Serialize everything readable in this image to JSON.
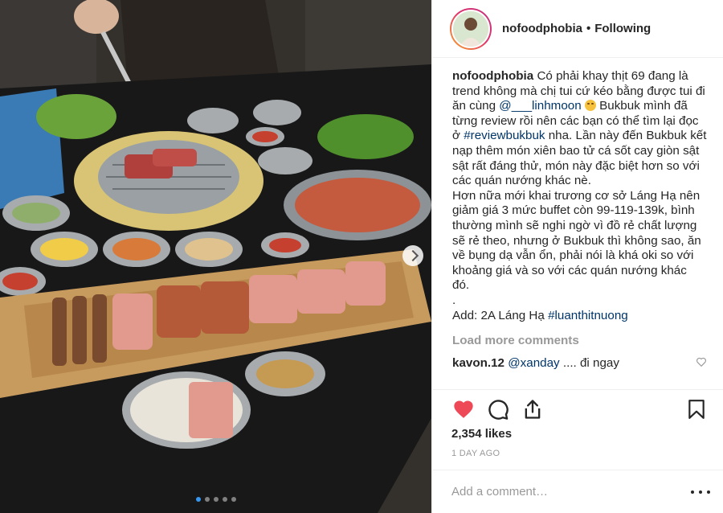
{
  "post": {
    "username": "nofoodphobia",
    "separator": "•",
    "follow_status": "Following",
    "caption": {
      "username": "nofoodphobia",
      "part1": " Có phải khay thịt 69 đang là trend không mà chị tui cứ kéo bằng được tui đi ăn cùng ",
      "mention": "@___linhmoon",
      "part2": " Bukbuk mình đã từng review rồi nên các bạn có thể tìm lại đọc ở ",
      "hashtag1": "#reviewbukbuk",
      "part3": " nha. Lần này đến Bukbuk kết nạp thêm món xiên bao tử cá sốt cay giòn sật sật rất đáng thử, món này đặc biệt hơn so với các quán nướng khác nè.",
      "para2": "Hơn nữa mới khai trương cơ sở Láng Hạ nên giảm giá 3 mức buffet còn 99-119-139k, bình thường mình sẽ nghi ngờ vì đồ rẻ chất lượng sẽ rẻ theo, nhưng ở Bukbuk thì không sao, ăn về bụng dạ vẫn ổn, phải nói là khá oki so với khoảng giá và so với các quán nướng khác đó.",
      "para3": ".",
      "address_prefix": "Add: 2A Láng Hạ ",
      "hashtag2": "#luanthitnuong"
    },
    "load_more_label": "Load more comments",
    "partial_comment": {
      "username": "kavon.12",
      "mention": "@xanday",
      "text": " .... đi ngay"
    },
    "likes": "2,354 likes",
    "time_ago": "1 DAY AGO",
    "add_comment_placeholder": "Add a comment…",
    "carousel": {
      "total": 5,
      "active": 1
    },
    "colors": {
      "like_red": "#ed4956",
      "link_blue": "#003569",
      "active_dot": "#3897f0",
      "muted": "#999999"
    },
    "icons": [
      "heart-icon",
      "comment-icon",
      "share-icon",
      "bookmark-icon",
      "more-options-icon"
    ]
  }
}
